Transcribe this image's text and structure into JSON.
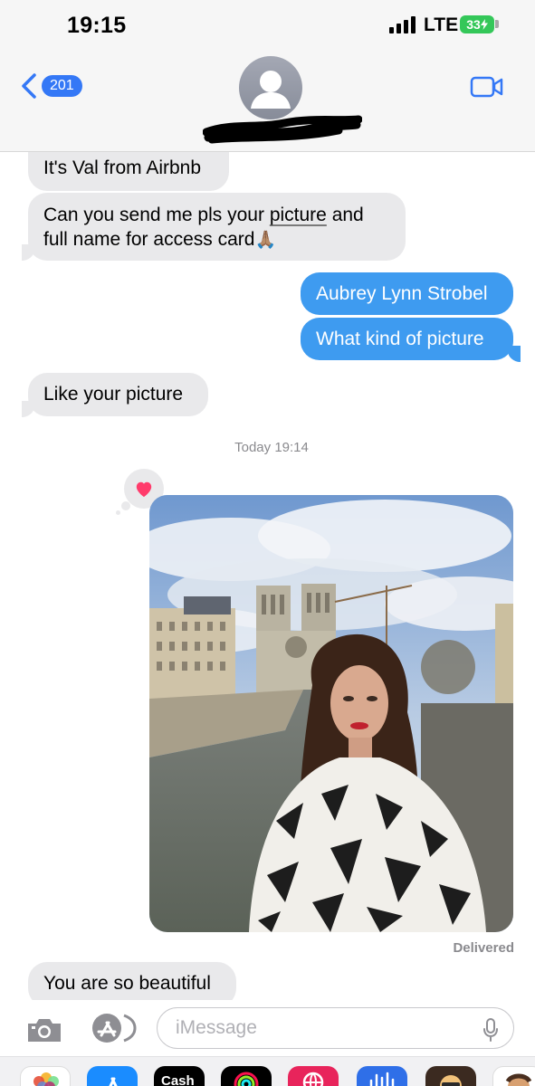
{
  "status_bar": {
    "time": "19:15",
    "network": "LTE",
    "battery": "33"
  },
  "header": {
    "back_count": "201",
    "back_icon": "chevron-left-icon",
    "avatar_icon": "person-silhouette-icon",
    "video_icon": "video-camera-icon"
  },
  "messages": [
    {
      "direction": "incoming",
      "text": "It's Val from Airbnb"
    },
    {
      "direction": "incoming",
      "lines": [
        "Can you send me pls your",
        "picture",
        "and",
        "full name for access card",
        "🙏🏽"
      ]
    },
    {
      "direction": "outgoing",
      "text": "Aubrey Lynn Strobel"
    },
    {
      "direction": "outgoing",
      "text": "What kind of picture"
    },
    {
      "direction": "incoming",
      "text": "Like your picture"
    },
    {
      "direction": "timestamp",
      "text": "Today 19:14"
    },
    {
      "direction": "outgoing",
      "type": "photo",
      "tapback": "heart"
    },
    {
      "direction": "status",
      "text": "Delivered"
    },
    {
      "direction": "incoming",
      "text": "You are so beautiful"
    }
  ],
  "input": {
    "placeholder": "iMessage",
    "camera_icon": "camera-icon",
    "apps_icon": "app-store-icon",
    "mic_icon": "microphone-icon"
  },
  "app_strip": {
    "cash_label": "Cash"
  },
  "colors": {
    "imessage_blue": "#3e9bf0",
    "incoming_gray": "#e9e9eb",
    "accent_blue": "#3478f6",
    "battery_green": "#34c759"
  }
}
